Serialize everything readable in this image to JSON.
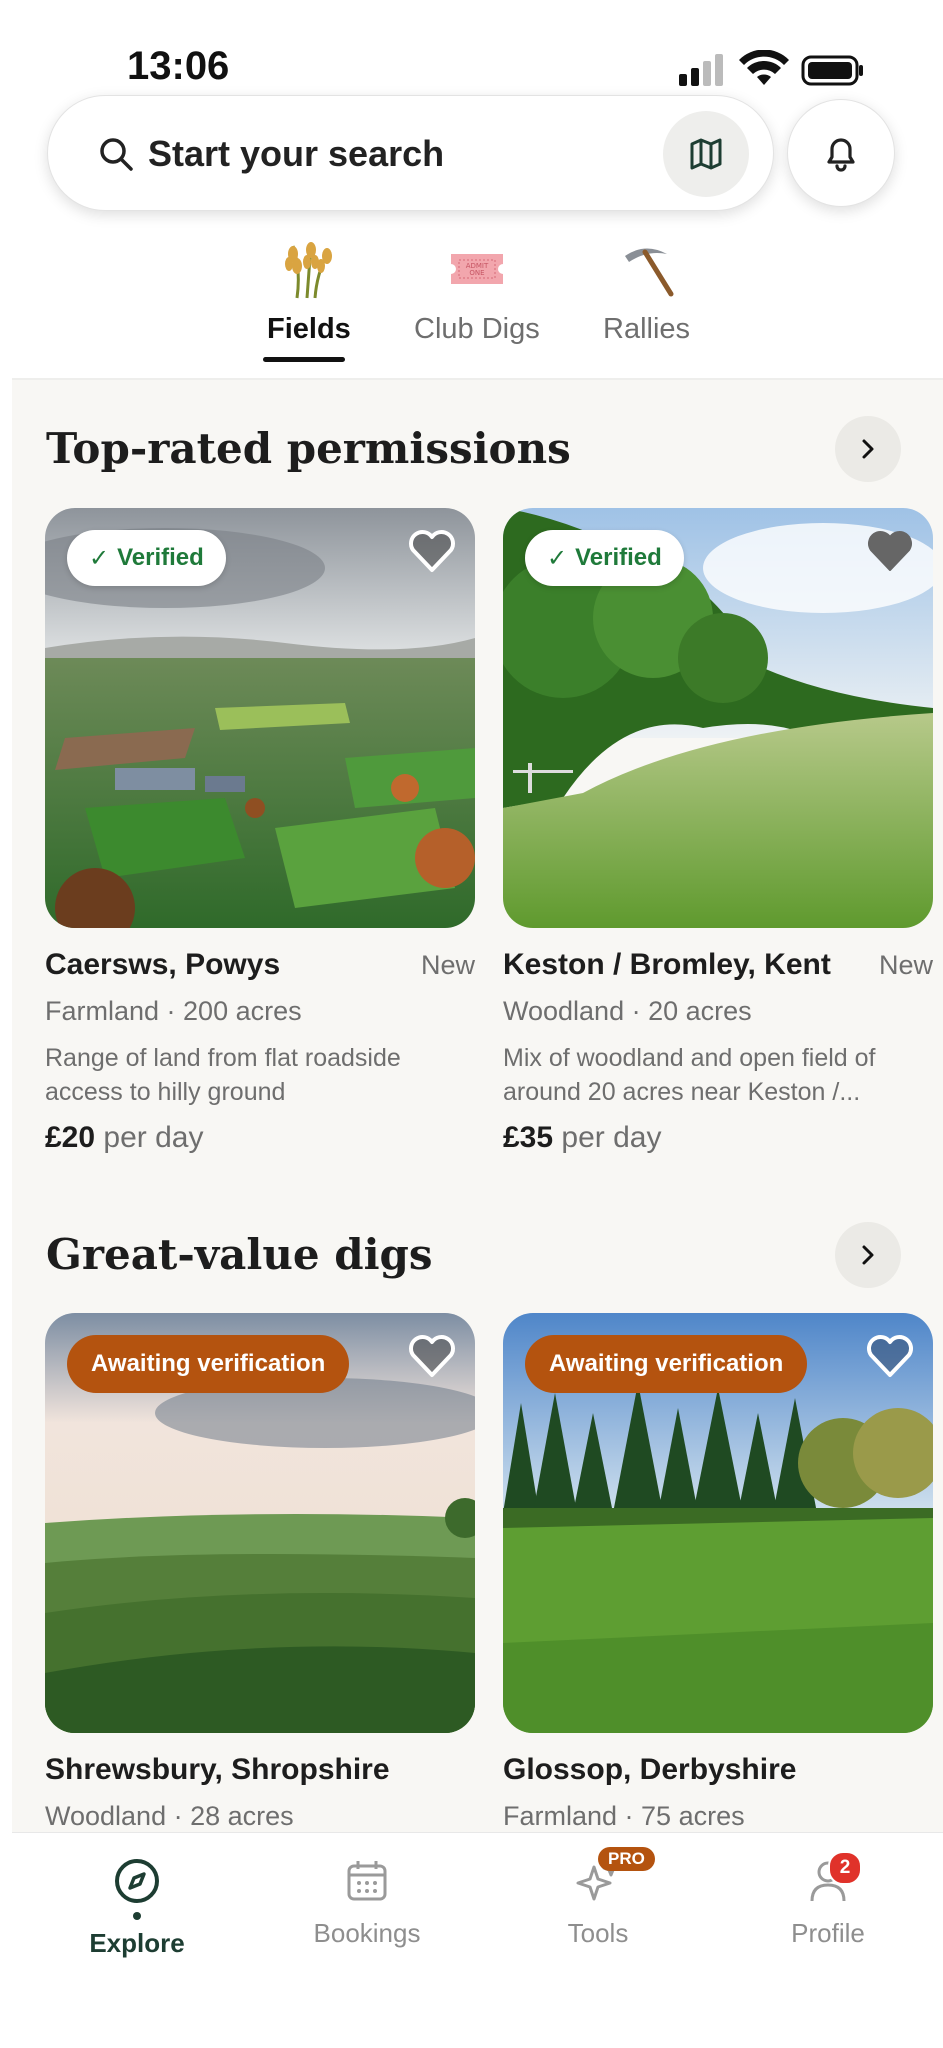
{
  "status_bar": {
    "time": "13:06"
  },
  "search": {
    "placeholder": "Start your search"
  },
  "categories": [
    {
      "label": "Fields",
      "icon": "wheat-icon",
      "active": true
    },
    {
      "label": "Club Digs",
      "icon": "ticket-icon",
      "active": false
    },
    {
      "label": "Rallies",
      "icon": "pickaxe-icon",
      "active": false
    }
  ],
  "sections": [
    {
      "title": "Top-rated permissions",
      "cards": [
        {
          "badge": "Verified",
          "title": "Caersws, Powys",
          "tag": "New",
          "meta": "Farmland · 200 acres",
          "description": "Range of land from flat roadside access to hilly ground",
          "price": "£20",
          "price_unit": "per day",
          "favorited": false
        },
        {
          "badge": "Verified",
          "title": "Keston / Bromley, Kent",
          "tag": "New",
          "meta": "Woodland · 20 acres",
          "description": "Mix of woodland and open field of around 20 acres near Keston /...",
          "price": "£35",
          "price_unit": "per day",
          "favorited": true
        }
      ]
    },
    {
      "title": "Great-value digs",
      "cards": [
        {
          "badge": "Awaiting verification",
          "title": "Shrewsbury, Shropshire",
          "meta": "Woodland · 28 acres",
          "favorited": false
        },
        {
          "badge": "Awaiting verification",
          "title": "Glossop, Derbyshire",
          "meta": "Farmland · 75 acres",
          "favorited": false
        }
      ]
    }
  ],
  "tabbar": [
    {
      "label": "Explore",
      "icon": "compass-icon",
      "active": true
    },
    {
      "label": "Bookings",
      "icon": "calendar-icon",
      "active": false
    },
    {
      "label": "Tools",
      "icon": "sparkle-icon",
      "badge": "PRO",
      "active": false
    },
    {
      "label": "Profile",
      "icon": "person-icon",
      "badge": "2",
      "active": false
    }
  ],
  "colors": {
    "verified_green": "#1f7a3a",
    "awaiting_orange": "#b4530f",
    "brand_dark_green": "#1d3d32"
  }
}
